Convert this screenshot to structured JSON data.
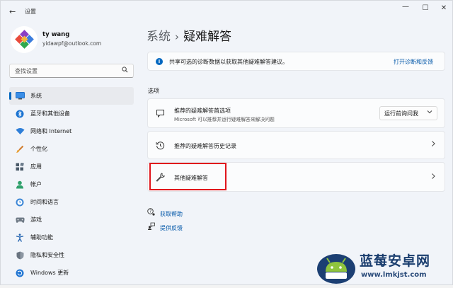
{
  "window": {
    "title": "设置",
    "back_glyph": "←",
    "controls": {
      "minimize": "—",
      "maximize": "☐",
      "close": "✕"
    }
  },
  "profile": {
    "name": "ty wang",
    "email": "yidawpf@outlook.com"
  },
  "search": {
    "placeholder": "查找设置"
  },
  "sidebar": {
    "items": [
      {
        "label": "系统",
        "icon": "monitor-icon",
        "active": true
      },
      {
        "label": "蓝牙和其他设备",
        "icon": "bluetooth-icon"
      },
      {
        "label": "网络和 Internet",
        "icon": "wifi-icon"
      },
      {
        "label": "个性化",
        "icon": "brush-icon"
      },
      {
        "label": "应用",
        "icon": "apps-icon"
      },
      {
        "label": "帐户",
        "icon": "person-icon"
      },
      {
        "label": "时间和语言",
        "icon": "globe-clock-icon"
      },
      {
        "label": "游戏",
        "icon": "gamepad-icon"
      },
      {
        "label": "辅助功能",
        "icon": "accessibility-icon"
      },
      {
        "label": "隐私和安全性",
        "icon": "shield-icon"
      },
      {
        "label": "Windows 更新",
        "icon": "update-icon"
      }
    ]
  },
  "breadcrumb": {
    "parent": "系统",
    "separator": "›",
    "current": "疑难解答"
  },
  "info_banner": {
    "text": "共享可选的诊断数据以获取其他疑难解答建议。",
    "link": "打开诊断和反馈"
  },
  "section": {
    "title": "选项"
  },
  "cards": {
    "recommended_prefs": {
      "title": "推荐的疑难解答首选项",
      "subtitle": "Microsoft 可以推荐并运行疑难解答来解决问题",
      "dropdown_value": "运行前询问我"
    },
    "history": {
      "title": "推荐的疑难解答历史记录"
    },
    "other": {
      "title": "其他疑难解答"
    }
  },
  "links": {
    "help": "获取帮助",
    "feedback": "提供反馈"
  },
  "watermark": {
    "title": "蓝莓安卓网",
    "url": "www.lmkjst.com"
  },
  "colors": {
    "accent": "#0067c0",
    "link": "#0056a8",
    "highlight_border": "#e0141c"
  }
}
